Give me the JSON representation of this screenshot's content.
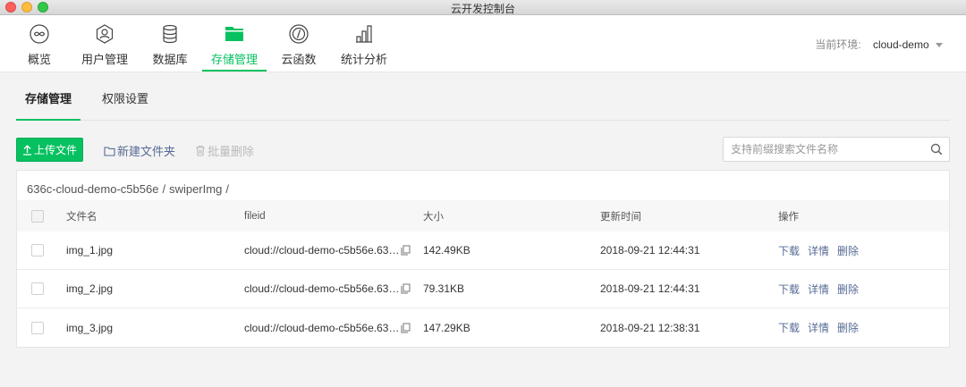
{
  "window": {
    "title": "云开发控制台"
  },
  "nav": {
    "items": [
      {
        "label": "概览",
        "icon": "overview-icon"
      },
      {
        "label": "用户管理",
        "icon": "user-management-icon"
      },
      {
        "label": "数据库",
        "icon": "database-icon"
      },
      {
        "label": "存储管理",
        "icon": "storage-folder-icon",
        "active": true
      },
      {
        "label": "云函数",
        "icon": "cloud-function-icon"
      },
      {
        "label": "统计分析",
        "icon": "statistics-icon"
      }
    ],
    "env_label": "当前环境:",
    "env_value": "cloud-demo"
  },
  "subtabs": [
    {
      "label": "存储管理",
      "active": true
    },
    {
      "label": "权限设置"
    }
  ],
  "toolbar": {
    "upload_label": "上传文件",
    "new_folder_label": "新建文件夹",
    "batch_delete_label": "批量删除",
    "search_placeholder": "支持前缀搜索文件名称"
  },
  "breadcrumb": [
    "636c-cloud-demo-c5b56e",
    "/",
    "swiperImg",
    "/"
  ],
  "table": {
    "headers": {
      "name": "文件名",
      "fileid": "fileid",
      "size": "大小",
      "time": "更新时间",
      "ops": "操作"
    },
    "rows": [
      {
        "name": "img_1.jpg",
        "fileid": "cloud://cloud-demo-c5b56e.63…",
        "size": "142.49KB",
        "time": "2018-09-21 12:44:31"
      },
      {
        "name": "img_2.jpg",
        "fileid": "cloud://cloud-demo-c5b56e.63…",
        "size": "79.31KB",
        "time": "2018-09-21 12:44:31"
      },
      {
        "name": "img_3.jpg",
        "fileid": "cloud://cloud-demo-c5b56e.63…",
        "size": "147.29KB",
        "time": "2018-09-21 12:38:31"
      }
    ],
    "ops": {
      "download": "下载",
      "detail": "详情",
      "delete": "删除"
    }
  },
  "colors": {
    "accent": "#07c160",
    "link": "#576b95"
  }
}
